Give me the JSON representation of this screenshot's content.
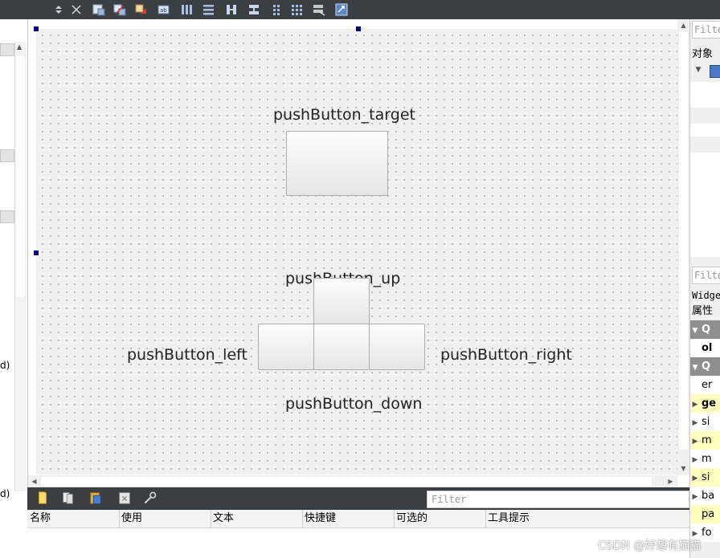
{
  "toolbar": {
    "icons": [
      "spin-arrows-icon",
      "close-x-icon",
      "edit-widgets-icon",
      "edit-signals-icon",
      "edit-buddies-icon",
      "edit-tab-order-icon",
      "layout-horizontal-icon",
      "layout-vertical-icon",
      "layout-h-splitter-icon",
      "layout-v-splitter-icon",
      "layout-form-icon",
      "layout-grid-icon",
      "break-layout-icon",
      "adjust-size-icon"
    ]
  },
  "left_panel": {
    "text_1": "d)",
    "text_2": "d)"
  },
  "form": {
    "label_target": "pushButton_target",
    "label_up": "pushButton_up",
    "label_left": "pushButton_left",
    "label_right": "pushButton_right",
    "label_down": "pushButton_down"
  },
  "action_editor": {
    "filter_placeholder": "Filter",
    "icons": [
      "new-action-icon",
      "copy-action-icon",
      "paste-action-icon",
      "delete-action-icon",
      "configure-icon"
    ],
    "columns": [
      "名称",
      "使用",
      "文本",
      "快捷键",
      "可选的",
      "工具提示"
    ]
  },
  "object_inspector": {
    "filter_placeholder": "Filter",
    "header": "对象"
  },
  "property_editor": {
    "filter_placeholder": "Filter",
    "class_label": "Widget",
    "header": "属性",
    "rows": [
      {
        "text": "Q",
        "kind": "gray",
        "expander": true
      },
      {
        "text": "ol",
        "kind": "white-bold",
        "expander": false
      },
      {
        "text": "Q",
        "kind": "gray",
        "expander": true
      },
      {
        "text": "er",
        "kind": "white",
        "expander": false
      },
      {
        "text": "ge",
        "kind": "yellow-bold",
        "expander": true
      },
      {
        "text": "si",
        "kind": "white",
        "expander": true
      },
      {
        "text": "m",
        "kind": "yellow",
        "expander": true
      },
      {
        "text": "m",
        "kind": "white",
        "expander": true
      },
      {
        "text": "si",
        "kind": "yellow",
        "expander": true
      },
      {
        "text": "ba",
        "kind": "white",
        "expander": true
      },
      {
        "text": "pa",
        "kind": "yellow",
        "expander": false
      },
      {
        "text": "fo",
        "kind": "white",
        "expander": true
      }
    ]
  },
  "watermark": "CSDN @好想有猫猫"
}
